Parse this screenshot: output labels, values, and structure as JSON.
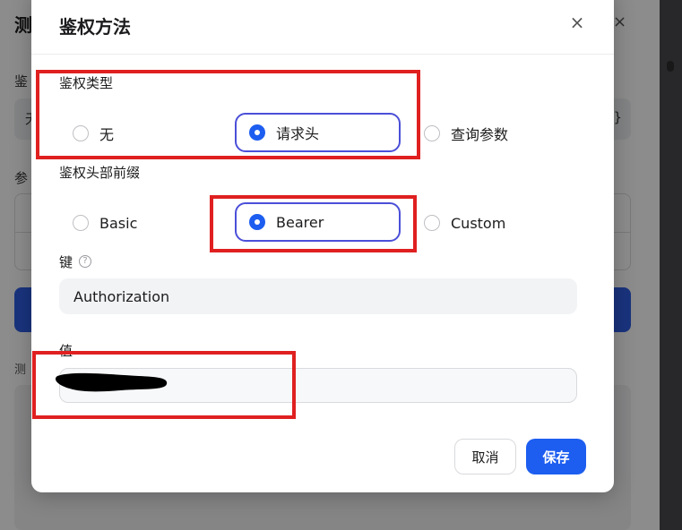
{
  "background": {
    "title": "测",
    "field_text": "无",
    "field_suffix": "}",
    "label_1": "鉴",
    "label_2": "参",
    "label_3": "测"
  },
  "modal": {
    "title": "鉴权方法",
    "close_glyph": "×",
    "auth_type": {
      "label": "鉴权类型",
      "options": [
        "无",
        "请求头",
        "查询参数"
      ],
      "selected": "请求头"
    },
    "header_prefix": {
      "label": "鉴权头部前缀",
      "options": [
        "Basic",
        "Bearer",
        "Custom"
      ],
      "selected": "Bearer"
    },
    "key": {
      "label": "键",
      "help_glyph": "?",
      "value": "Authorization"
    },
    "value_field": {
      "label": "值",
      "value": ""
    },
    "buttons": {
      "cancel": "取消",
      "save": "保存"
    }
  },
  "colors": {
    "primary": "#1d5ef0",
    "selected_border": "#4b4fd8",
    "annotation_red": "#e02020"
  }
}
